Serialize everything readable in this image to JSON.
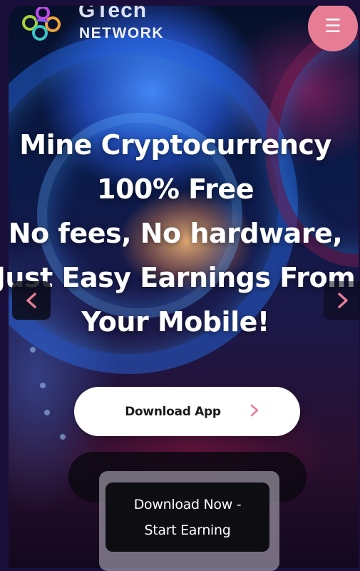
{
  "header": {
    "brand_top": "GTech",
    "brand_bottom": "NETWORK",
    "logo_icon": "network-nodes-icon",
    "menu_icon": "hamburger-menu-icon"
  },
  "hero": {
    "lines": [
      "Mine Cryptocurrency",
      "100% Free",
      "No fees, No hardware,",
      "Just Easy Earnings From",
      "Your Mobile!"
    ]
  },
  "carousel": {
    "prev_icon": "chevron-left-icon",
    "next_icon": "chevron-right-icon"
  },
  "buttons": {
    "download_app": "Download App",
    "download_app_icon": "chevron-right-icon"
  },
  "popup": {
    "line1": "Download Now -",
    "line2": "Start Earning"
  },
  "colors": {
    "accent": "#e77d95",
    "button_bg": "#ffffff",
    "popup_bg": "#0d0d12"
  }
}
